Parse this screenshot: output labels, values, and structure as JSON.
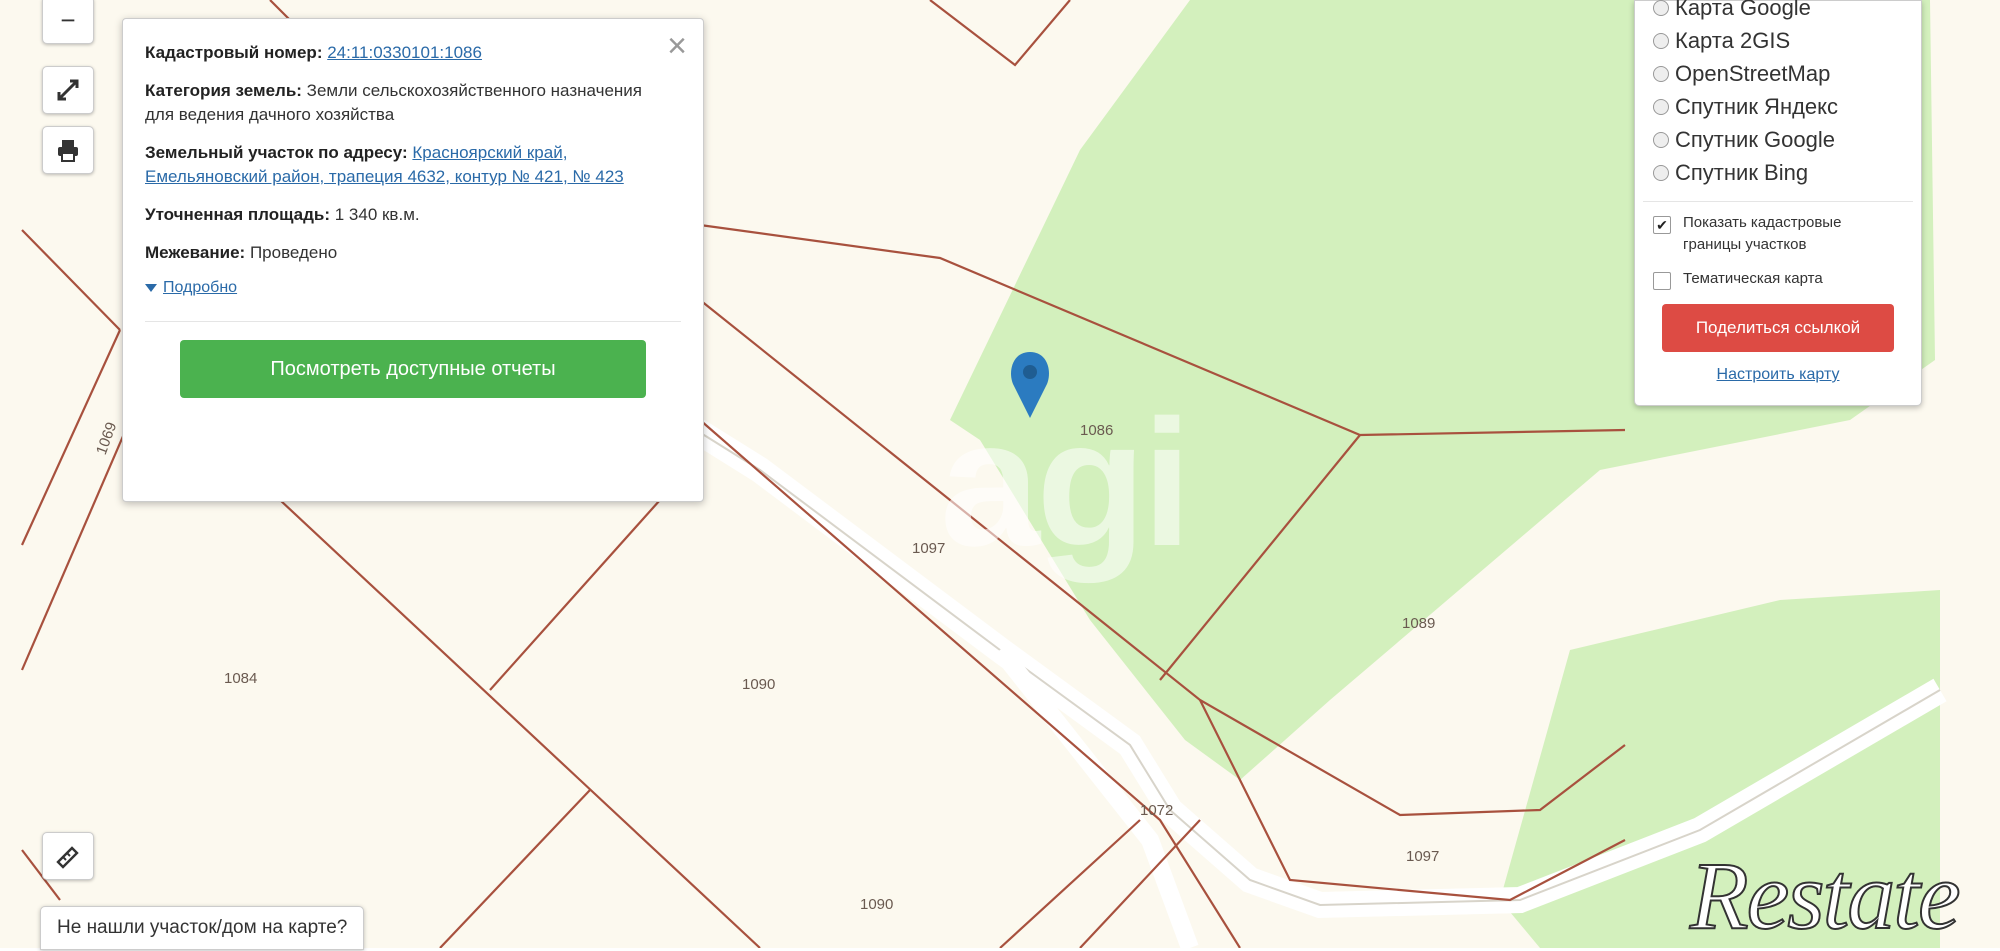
{
  "map": {
    "watermark": "agi",
    "parcels": [
      {
        "id": "p1086",
        "label": "1086"
      },
      {
        "id": "p1097a",
        "label": "1097"
      },
      {
        "id": "p1089",
        "label": "1089"
      },
      {
        "id": "p1084",
        "label": "1084"
      },
      {
        "id": "p1090a",
        "label": "1090"
      },
      {
        "id": "p1072",
        "label": "1072"
      },
      {
        "id": "p1097b",
        "label": "1097"
      },
      {
        "id": "p1090b",
        "label": "1090"
      },
      {
        "id": "p1069",
        "label": "1069"
      }
    ],
    "colors": {
      "background": "#fcf9ef",
      "forest": "#d3f0bd",
      "boundary": "#a8513e",
      "road": "#ffffff",
      "marker": "#2b7bc0"
    }
  },
  "controls": {
    "zoom_out": "−",
    "fullscreen_icon": "expand-icon",
    "print_icon": "printer-icon",
    "ruler_icon": "ruler-icon"
  },
  "popup": {
    "cadastral_label": "Кадастровый номер:",
    "cadastral_value": "24:11:0330101:1086",
    "category_label": "Категория земель:",
    "category_value": "Земли сельскохозяйственного назначения",
    "usage_value": "для ведения дачного хозяйства",
    "address_label": "Земельный участок по адресу:",
    "address_value": "Красноярский край, Емельяновский район, трапеция 4632, контур № 421, № 423",
    "area_label": "Уточненная площадь:",
    "area_value": "1 340 кв.м.",
    "survey_label": "Межевание:",
    "survey_value": "Проведено",
    "details_link": "Подробно",
    "reports_button": "Посмотреть доступные отчеты",
    "close": "×"
  },
  "layers": {
    "options": [
      {
        "label": "Карта Google",
        "selected": false
      },
      {
        "label": "Карта 2GIS",
        "selected": false
      },
      {
        "label": "OpenStreetMap",
        "selected": false
      },
      {
        "label": "Спутник Яндекс",
        "selected": false
      },
      {
        "label": "Спутник Google",
        "selected": false
      },
      {
        "label": "Спутник Bing",
        "selected": false
      }
    ],
    "show_borders": "Показать кадастровые границы участков",
    "show_borders_checked": true,
    "thematic_map": "Тематическая карта",
    "thematic_checked": false,
    "share_button": "Поделиться ссылкой",
    "settings_link": "Настроить карту"
  },
  "not_found_button": "Не нашли участок/дом на карте?",
  "brand": "Restate"
}
